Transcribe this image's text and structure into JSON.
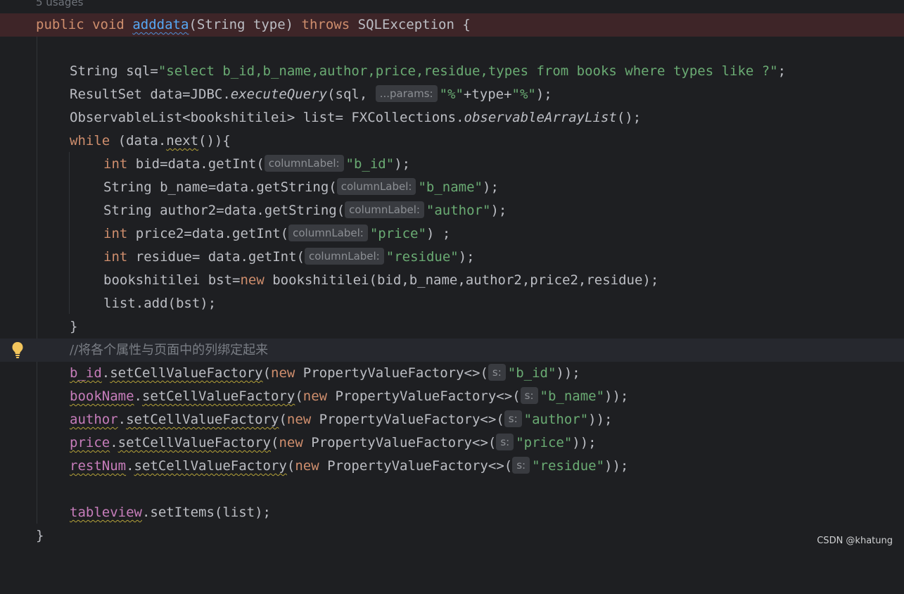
{
  "editor": {
    "usages": "5 usages",
    "lines": {
      "l1": {
        "kw_public": "public",
        "kw_void": "void",
        "method_name": "adddata",
        "params": "(String type) ",
        "kw_throws": "throws",
        "rest": " SQLException {"
      },
      "l3": {
        "pre": "String sql=",
        "str": "\"select b_id,b_name,author,price,residue,types from books where types like ?\"",
        "post": ";"
      },
      "l4": {
        "pre": "ResultSet data=JDBC.",
        "method": "executeQuery",
        "mid": "(sql, ",
        "hint": "...params:",
        "str1": "\"%\"",
        "plus1": "+type+",
        "str2": "\"%\"",
        "post": ");"
      },
      "l5": {
        "pre": "ObservableList<bookshitilei> list= FXCollections.",
        "method": "observableArrayList",
        "post": "();"
      },
      "l6": {
        "kw": "while",
        "pre": " (data.",
        "next": "next",
        "post": "()){"
      },
      "l7": {
        "kw": "int",
        "pre": " bid=data.getInt(",
        "hint": "columnLabel:",
        "str": "\"b_id\"",
        "post": ");"
      },
      "l8": {
        "pre": "String b_name=data.getString(",
        "hint": "columnLabel:",
        "str": "\"b_name\"",
        "post": ");"
      },
      "l9": {
        "pre": "String author2=data.getString(",
        "hint": "columnLabel:",
        "str": "\"author\"",
        "post": ");"
      },
      "l10": {
        "kw": "int",
        "pre": " price2=data.getInt(",
        "hint": "columnLabel:",
        "str": "\"price\"",
        "post": ") ;"
      },
      "l11": {
        "kw": "int",
        "pre": " residue= data.getInt(",
        "hint": "columnLabel:",
        "str": "\"residue\"",
        "post": ");"
      },
      "l12": {
        "pre": "bookshitilei bst=",
        "kw": "new",
        "post": " bookshitilei(bid,b_name,author2,price2,residue);"
      },
      "l13": {
        "text": "list.add(bst);"
      },
      "l14": {
        "text": "}"
      },
      "l15": {
        "comment": "//将各个属性与页面中的列绑定起来"
      },
      "l16": {
        "field": "b_id",
        "dot": ".",
        "method": "setCellValueFactory",
        "open": "(",
        "kw": "new",
        "mid": " PropertyValueFactory<>(",
        "hint": "s:",
        "str": "\"b_id\"",
        "post": "));"
      },
      "l17": {
        "field": "bookName",
        "dot": ".",
        "method": "setCellValueFactory",
        "open": "(",
        "kw": "new",
        "mid": " PropertyValueFactory<>(",
        "hint": "s:",
        "str": "\"b_name\"",
        "post": "));"
      },
      "l18": {
        "field": "author",
        "dot": ".",
        "method": "setCellValueFactory",
        "open": "(",
        "kw": "new",
        "mid": " PropertyValueFactory<>(",
        "hint": "s:",
        "str": "\"author\"",
        "post": "));"
      },
      "l19": {
        "field": "price",
        "dot": ".",
        "method": "setCellValueFactory",
        "open": "(",
        "kw": "new",
        "mid": " PropertyValueFactory<>(",
        "hint": "s:",
        "str": "\"price\"",
        "post": "));"
      },
      "l20": {
        "field": "restNum",
        "dot": ".",
        "method": "setCellValueFactory",
        "open": "(",
        "kw": "new",
        "mid": " PropertyValueFactory<>(",
        "hint": "s:",
        "str": "\"residue\"",
        "post": "));"
      },
      "l22": {
        "field": "tableview",
        "post": ".setItems(list);"
      },
      "l23": {
        "text": "}"
      }
    }
  },
  "icons": {
    "intention": "lightbulb-icon"
  },
  "colors": {
    "keyword": "#cf8e6d",
    "string": "#6aab73",
    "field": "#c77dbb",
    "method": "#56a8f5",
    "error_line": "#3e2528"
  },
  "watermark": "CSDN @khatung"
}
